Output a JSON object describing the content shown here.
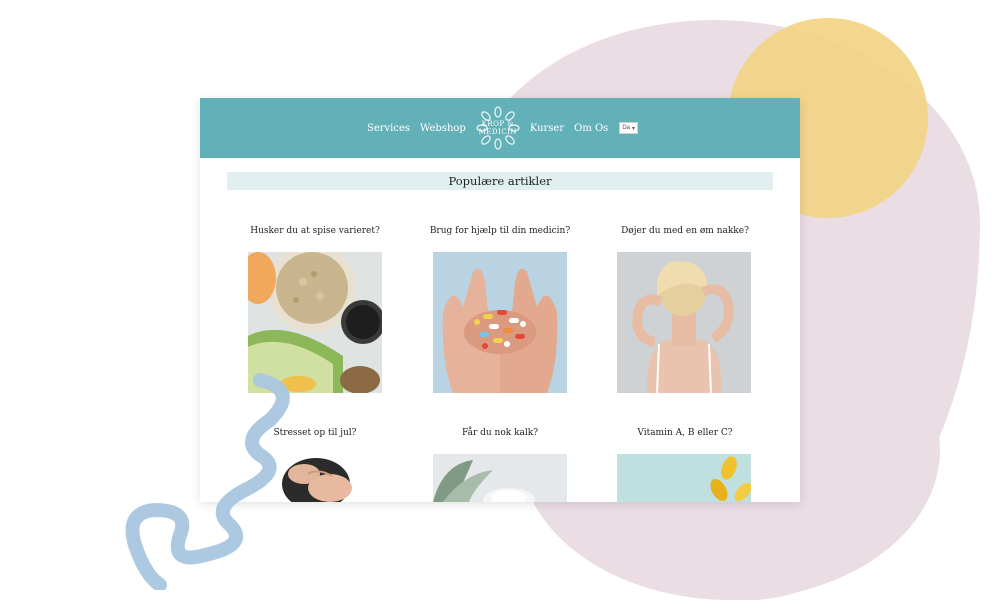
{
  "nav": {
    "links_left": [
      "Services",
      "Webshop"
    ],
    "logo_lines": [
      "KROP &",
      "MEDICIN"
    ],
    "links_right": [
      "Kurser",
      "Om Os"
    ],
    "language": "Da"
  },
  "section": {
    "title": "Populære artikler"
  },
  "articles": [
    {
      "title": "Husker du at spise varieret?",
      "image": "oats-and-cucumber-photo"
    },
    {
      "title": "Brug for hjælp til din medicin?",
      "image": "hands-with-pills-photo"
    },
    {
      "title": "Døjer du med en øm nakke?",
      "image": "woman-neck-pain-photo"
    },
    {
      "title": "Stresset op til jul?",
      "image": "stressed-person-photo"
    },
    {
      "title": "Får du nok kalk?",
      "image": "calcium-photo"
    },
    {
      "title": "Vitamin A, B eller C?",
      "image": "vitamin-capsules-photo"
    }
  ],
  "colors": {
    "header": "#63b1b8",
    "section_bg": "#e2eff0",
    "blob_pink": "#eadde3",
    "blob_yellow": "#f2d485",
    "squiggle": "#a9c6df"
  }
}
